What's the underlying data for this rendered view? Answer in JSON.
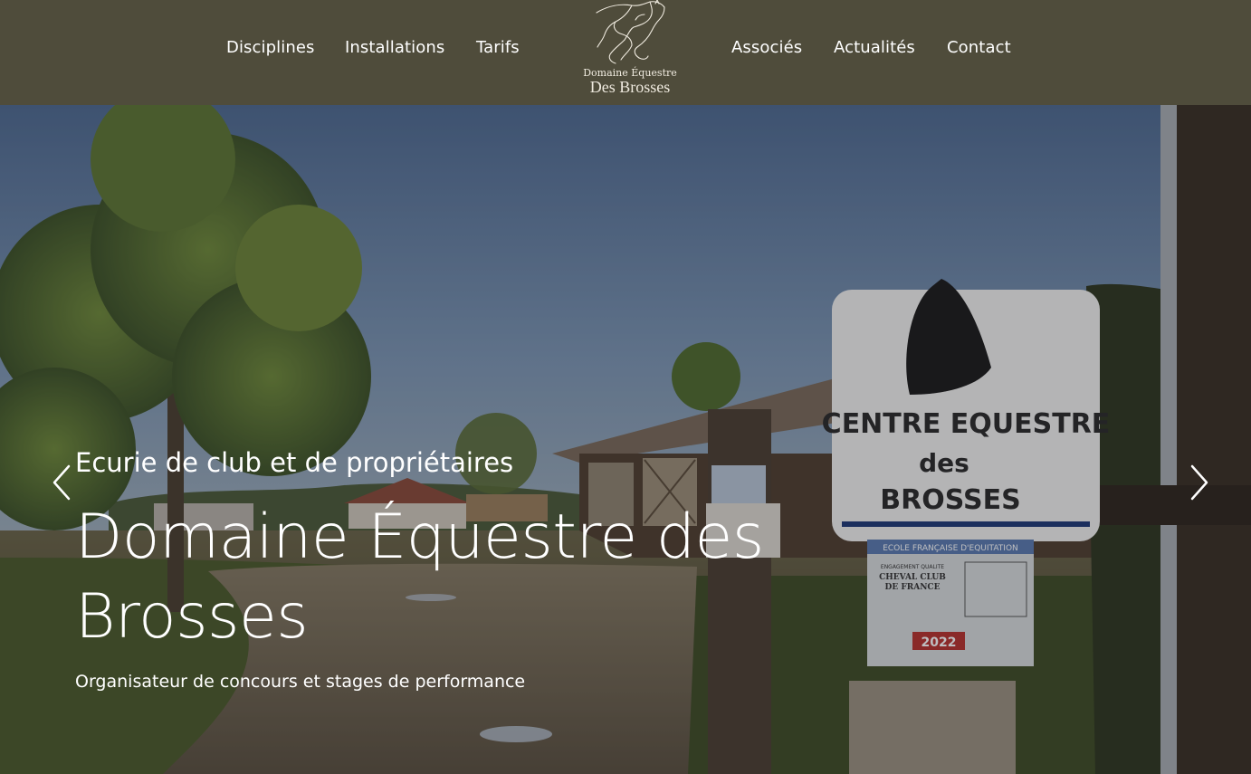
{
  "nav": {
    "left": [
      "Disciplines",
      "Installations",
      "Tarifs"
    ],
    "right": [
      "Associés",
      "Actualités",
      "Contact"
    ]
  },
  "logo": {
    "line1": "Domaine Équestre",
    "line2": "Des Brosses"
  },
  "hero": {
    "subtitle": "Ecurie de club et de propriétaires",
    "title": "Domaine Équestre des Brosses",
    "tagline": "Organisateur de concours et stages de performance",
    "prev_icon": "chevron-left-icon",
    "next_icon": "chevron-right-icon"
  },
  "sign": {
    "line1": "CENTRE EQUESTRE",
    "line2": "des",
    "line3": "BROSSES",
    "plaque_header": "ECOLE FRANÇAISE D'EQUITATION",
    "plaque_sub1": "ENGAGEMENT QUALITE",
    "plaque_sub2": "CHEVAL CLUB",
    "plaque_sub3": "DE FRANCE",
    "plaque_year": "2022"
  },
  "colors": {
    "header_bg": "#4f4c3b",
    "text": "#ffffff",
    "logo_text": "#efeadf"
  }
}
